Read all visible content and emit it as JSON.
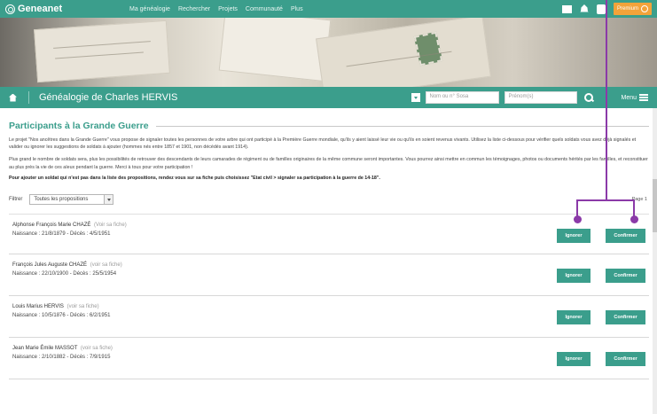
{
  "topnav": {
    "logo": "Geneanet",
    "menu": [
      "Ma généalogie",
      "Rechercher",
      "Projets",
      "Communauté",
      "Plus"
    ],
    "premium": "Premium"
  },
  "titlebar": {
    "title": "Généalogie de Charles HERVIS",
    "search_number_placeholder": "Nom ou n° Sosa",
    "search_first_placeholder": "Prénom(s)",
    "menu_label": "Menu"
  },
  "section": {
    "heading": "Participants à la Grande Guerre",
    "para1": "Le projet \"Nos ancêtres dans la Grande Guerre\" vous propose de signaler toutes les personnes de votre arbre qui ont participé à la Première Guerre mondiale, qu'ils y aient laissé leur vie ou qu'ils en soient revenus vivants. Utilisez la liste ci-dessous pour vérifier quels soldats vous avez déjà signalés et valider ou ignorer les suggestions de soldats à ajouter (hommes nés entre 1857 et 1901, non décédés avant 1914).",
    "para2": "Plus grand le nombre de soldats sera, plus les possibilités de retrouver des descendants de leurs camarades de régiment ou de familles originaires de la même commune seront importantes. Vous pourrez ainsi mettre en commun les témoignages, photos ou documents hérités par les familles, et reconstituer au plus près la vie de ces aïeux pendant la guerre. Merci à tous pour votre participation !",
    "para3": "Pour ajouter un soldat qui n'est pas dans la liste des propositions, rendez vous sur sa fiche puis choisissez \"Etat civil > signaler sa participation à la guerre de 14-18\"."
  },
  "filter": {
    "label": "Filtrer",
    "selected": "Toutes les propositions",
    "page": "Page 1"
  },
  "soldiers": [
    {
      "name": "Alphonse François Marie CHAZÉ",
      "link": "(Voir sa fiche)",
      "info": "Naissance : 21/8/1879 - Décès : 4/5/1951"
    },
    {
      "name": "François Jules Auguste CHAZÉ",
      "link": "(voir sa fiche)",
      "info": "Naissance : 22/10/1900 - Décès : 25/5/1954"
    },
    {
      "name": "Louis Marius HERVIS",
      "link": "(voir sa fiche)",
      "info": "Naissance : 10/5/1876 - Décès : 6/2/1951"
    },
    {
      "name": "Jean Marie Émile MASSOT",
      "link": "(voir sa fiche)",
      "info": "Naissance : 2/10/1882 - Décès : 7/9/1915"
    }
  ],
  "buttons": {
    "ignore": "Ignorer",
    "confirm": "Confirmer"
  },
  "colors": {
    "brand": "#3b9e8c",
    "premium": "#f2a33a",
    "annotation": "#8b3aa8"
  }
}
